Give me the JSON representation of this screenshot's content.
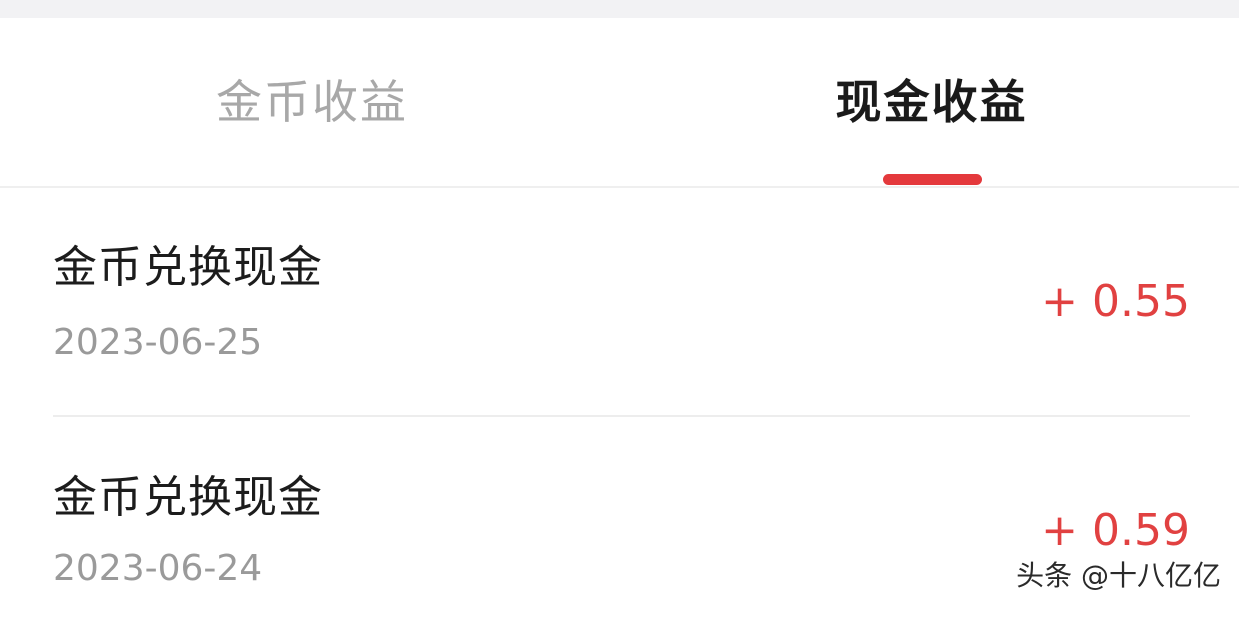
{
  "tabs": {
    "coin_income": "金币收益",
    "cash_income": "现金收益",
    "active": "cash_income"
  },
  "records": [
    {
      "title": "金币兑换现金",
      "date": "2023-06-25",
      "amount": "+ 0.55"
    },
    {
      "title": "金币兑换现金",
      "date": "2023-06-24",
      "amount": "+ 0.59"
    }
  ],
  "watermark": "头条 @十八亿亿",
  "colors": {
    "accent": "#e4393c",
    "amount": "#e14141",
    "inactive_tab": "#a8a8a8",
    "active_tab": "#1a1a1a"
  }
}
